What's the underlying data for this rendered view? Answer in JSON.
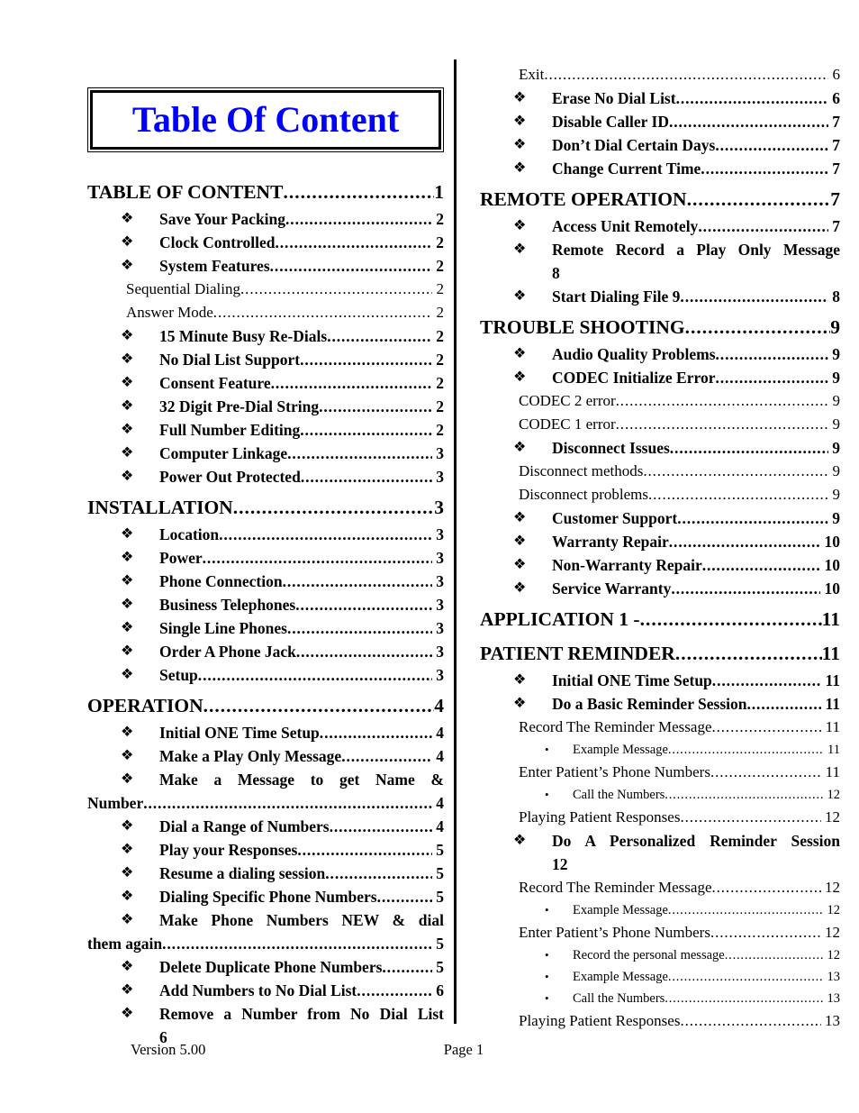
{
  "title": {
    "text": "Table Of Content",
    "color": "#0000FF"
  },
  "bullets": {
    "level2": "❖",
    "level4": "•"
  },
  "footer": {
    "version": "Version 5.00",
    "page": "Page 1"
  },
  "columns": {
    "left": [
      {
        "level": 1,
        "label": "TABLE OF CONTENT",
        "page": "1"
      },
      {
        "level": 2,
        "label": "Save Your Packing",
        "page": "2"
      },
      {
        "level": 2,
        "label": "Clock Controlled",
        "page": "2"
      },
      {
        "level": 2,
        "label": "System Features",
        "page": "2"
      },
      {
        "level": 3,
        "label": "Sequential Dialing",
        "page": "2"
      },
      {
        "level": 3,
        "label": "Answer Mode",
        "page": "2"
      },
      {
        "level": 2,
        "label": "15 Minute Busy Re-Dials",
        "page": "2"
      },
      {
        "level": 2,
        "label": "No Dial List Support",
        "page": "2"
      },
      {
        "level": 2,
        "label": "Consent Feature",
        "page": "2"
      },
      {
        "level": 2,
        "label": "32 Digit Pre-Dial String",
        "page": "2"
      },
      {
        "level": 2,
        "label": "Full Number Editing",
        "page": "2"
      },
      {
        "level": 2,
        "label": "Computer Linkage",
        "page": "3"
      },
      {
        "level": 2,
        "label": "Power Out Protected",
        "page": "3"
      },
      {
        "level": 1,
        "label": "INSTALLATION",
        "page": "3"
      },
      {
        "level": 2,
        "label": "Location",
        "page": "3"
      },
      {
        "level": 2,
        "label": "Power",
        "page": "3"
      },
      {
        "level": 2,
        "label": "Phone Connection",
        "page": "3"
      },
      {
        "level": 2,
        "label": "Business Telephones",
        "page": "3"
      },
      {
        "level": 2,
        "label": "Single Line Phones",
        "page": "3"
      },
      {
        "level": 2,
        "label": "Order A Phone Jack",
        "page": "3"
      },
      {
        "level": 2,
        "label": "Setup",
        "page": "3"
      },
      {
        "level": 1,
        "label": "OPERATION",
        "page": "4"
      },
      {
        "level": 2,
        "label": "Initial ONE Time Setup",
        "page": "4"
      },
      {
        "level": 2,
        "label": "Make a Play Only Message",
        "page": "4"
      },
      {
        "level": 2,
        "wrap": true,
        "line1": "Make a Message to get Name &",
        "line2": "Number",
        "leader2": true,
        "page": "4"
      },
      {
        "level": 2,
        "label": "Dial a Range of Numbers",
        "page": "4"
      },
      {
        "level": 2,
        "label": "Play your Responses",
        "page": "5"
      },
      {
        "level": 2,
        "label": "Resume a dialing session",
        "page": "5"
      },
      {
        "level": 2,
        "label": "Dialing Specific Phone Numbers",
        "page": "5"
      },
      {
        "level": 2,
        "wrap": true,
        "line1": "Make Phone Numbers NEW & dial",
        "line2": "them again",
        "leader2": true,
        "page": "5"
      },
      {
        "level": 2,
        "label": "Delete Duplicate Phone Numbers",
        "page": "5"
      },
      {
        "level": 2,
        "label": "Add Numbers to No Dial List",
        "page": "6"
      },
      {
        "level": 2,
        "wrap": true,
        "line1": "Remove a Number from No Dial List",
        "line2": "6",
        "leader2": false,
        "indent2": true,
        "page": ""
      }
    ],
    "right": [
      {
        "level": 3,
        "label": "Exit",
        "page": "6"
      },
      {
        "level": 2,
        "label": "Erase No Dial List",
        "page": "6"
      },
      {
        "level": 2,
        "label": "Disable Caller ID",
        "page": "7"
      },
      {
        "level": 2,
        "label": "Don’t Dial Certain Days",
        "page": "7"
      },
      {
        "level": 2,
        "label": "Change Current Time",
        "page": "7"
      },
      {
        "level": 1,
        "label": "REMOTE OPERATION",
        "page": "7"
      },
      {
        "level": 2,
        "label": "Access Unit Remotely",
        "page": "7"
      },
      {
        "level": 2,
        "wrap": true,
        "line1": "Remote Record a Play Only Message",
        "line2": "8",
        "leader2": false,
        "indent2": true,
        "page": ""
      },
      {
        "level": 2,
        "label": "Start Dialing File 9",
        "page": "8"
      },
      {
        "level": 1,
        "label": "TROUBLE SHOOTING",
        "page": "9"
      },
      {
        "level": 2,
        "label": "Audio Quality Problems",
        "page": "9"
      },
      {
        "level": 2,
        "label": "CODEC Initialize Error",
        "page": "9"
      },
      {
        "level": 3,
        "label": "CODEC 2 error",
        "page": "9"
      },
      {
        "level": 3,
        "label": "CODEC 1 error",
        "page": "9"
      },
      {
        "level": 2,
        "label": "Disconnect Issues",
        "page": "9"
      },
      {
        "level": 3,
        "label": "Disconnect methods",
        "page": "9"
      },
      {
        "level": 3,
        "label": "Disconnect problems",
        "page": "9"
      },
      {
        "level": 2,
        "label": "Customer Support",
        "page": "9"
      },
      {
        "level": 2,
        "label": "Warranty Repair",
        "page": "10"
      },
      {
        "level": 2,
        "label": "Non-Warranty Repair",
        "page": "10"
      },
      {
        "level": 2,
        "label": "Service Warranty",
        "page": "10"
      },
      {
        "level": 1,
        "label": "APPLICATION 1 -",
        "page": "11"
      },
      {
        "level": 1,
        "label": "PATIENT REMINDER",
        "page": "11"
      },
      {
        "level": 2,
        "label": "Initial ONE Time Setup",
        "page": "11"
      },
      {
        "level": 2,
        "label": "Do a Basic Reminder Session",
        "page": "11"
      },
      {
        "level": 3,
        "label": "Record The Reminder Message",
        "page": "11"
      },
      {
        "level": 4,
        "label": "Example Message",
        "page": "11"
      },
      {
        "level": 3,
        "label": "Enter Patient’s Phone Numbers",
        "page": "11"
      },
      {
        "level": 4,
        "label": "Call the Numbers",
        "page": "12"
      },
      {
        "level": 3,
        "label": "Playing Patient Responses",
        "page": "12"
      },
      {
        "level": 2,
        "wrap": true,
        "line1": "Do A Personalized Reminder Session",
        "line2": "12",
        "leader2": false,
        "indent2": true,
        "page": ""
      },
      {
        "level": 3,
        "label": "Record The Reminder Message",
        "page": "12"
      },
      {
        "level": 4,
        "label": "Example Message",
        "page": "12"
      },
      {
        "level": 3,
        "label": "Enter Patient’s Phone Numbers",
        "page": "12"
      },
      {
        "level": 4,
        "label": "Record the personal message",
        "page": "12"
      },
      {
        "level": 4,
        "label": "Example Message",
        "page": "13"
      },
      {
        "level": 4,
        "label": "Call the Numbers",
        "page": "13"
      },
      {
        "level": 3,
        "label": "Playing Patient Responses",
        "page": "13"
      }
    ]
  }
}
